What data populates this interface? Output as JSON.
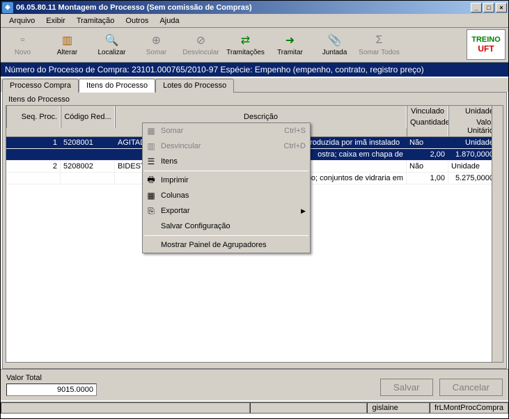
{
  "window": {
    "title": "06.05.80.11 Montagem do Processo  (Sem comissão de Compras)"
  },
  "menu": {
    "arquivo": "Arquivo",
    "exibir": "Exibir",
    "tramitacao": "Tramitação",
    "outros": "Outros",
    "ajuda": "Ajuda"
  },
  "toolbar": {
    "novo": "Novo",
    "alterar": "Alterar",
    "localizar": "Localizar",
    "somar": "Somar",
    "desvincular": "Desvincular",
    "tramitacoes": "Tramitações",
    "tramitar": "Tramitar",
    "juntada": "Juntada",
    "somar_todos": "Somar Todos",
    "logo_line1": "TREINO",
    "logo_line2": "UFT"
  },
  "infobar": "Número do Processo de Compra: 23101.000765/2010-97  Espécie: Empenho (empenho, contrato, registro preço)",
  "tabs": {
    "processo_compra": "Processo Compra",
    "itens_processo": "Itens do Processo",
    "lotes_processo": "Lotes do Processo"
  },
  "group": {
    "label": "Itens do Processo"
  },
  "grid": {
    "head": {
      "seq": "Seq. Proc.",
      "codigo": "Código Red...",
      "descricao": "Descrição",
      "vinculado": "Vinculado",
      "unidade": "Unidade",
      "quantidade": "Quantidade",
      "valor_unit": "Valor Unitário"
    },
    "rows": [
      {
        "seq": "1",
        "codigo": "5208001",
        "descricao": "AGITADOR MAGNÉTICO, com aquecimento; agitação produzida por imã instalado",
        "desc_cont": "ostra; caixa em chapa de",
        "vinc": "Não",
        "unid": "Unidade",
        "qtd": "2,00",
        "valor": "1.870,0000"
      },
      {
        "seq": "2",
        "codigo": "5208002",
        "descricao": "BIDESTI",
        "desc_cont": "quartzo, livre de progênio; conjuntos de vidraria em",
        "vinc": "Não",
        "unid": "Unidade",
        "qtd": "1,00",
        "valor": "5.275,0000"
      }
    ]
  },
  "context_menu": {
    "somar": "Somar",
    "somar_key": "Ctrl+S",
    "desvincular": "Desvincular",
    "desvincular_key": "Ctrl+D",
    "itens": "Itens",
    "imprimir": "Imprimir",
    "colunas": "Colunas",
    "exportar": "Exportar",
    "salvar_conf": "Salvar Configuração",
    "mostrar_agrup": "Mostrar Painel de Agrupadores"
  },
  "footer": {
    "valor_total_label": "Valor Total",
    "valor_total": "9015.0000",
    "salvar": "Salvar",
    "cancelar": "Cancelar"
  },
  "status": {
    "user": "gislaine",
    "form": "frLMontProcCompra"
  }
}
